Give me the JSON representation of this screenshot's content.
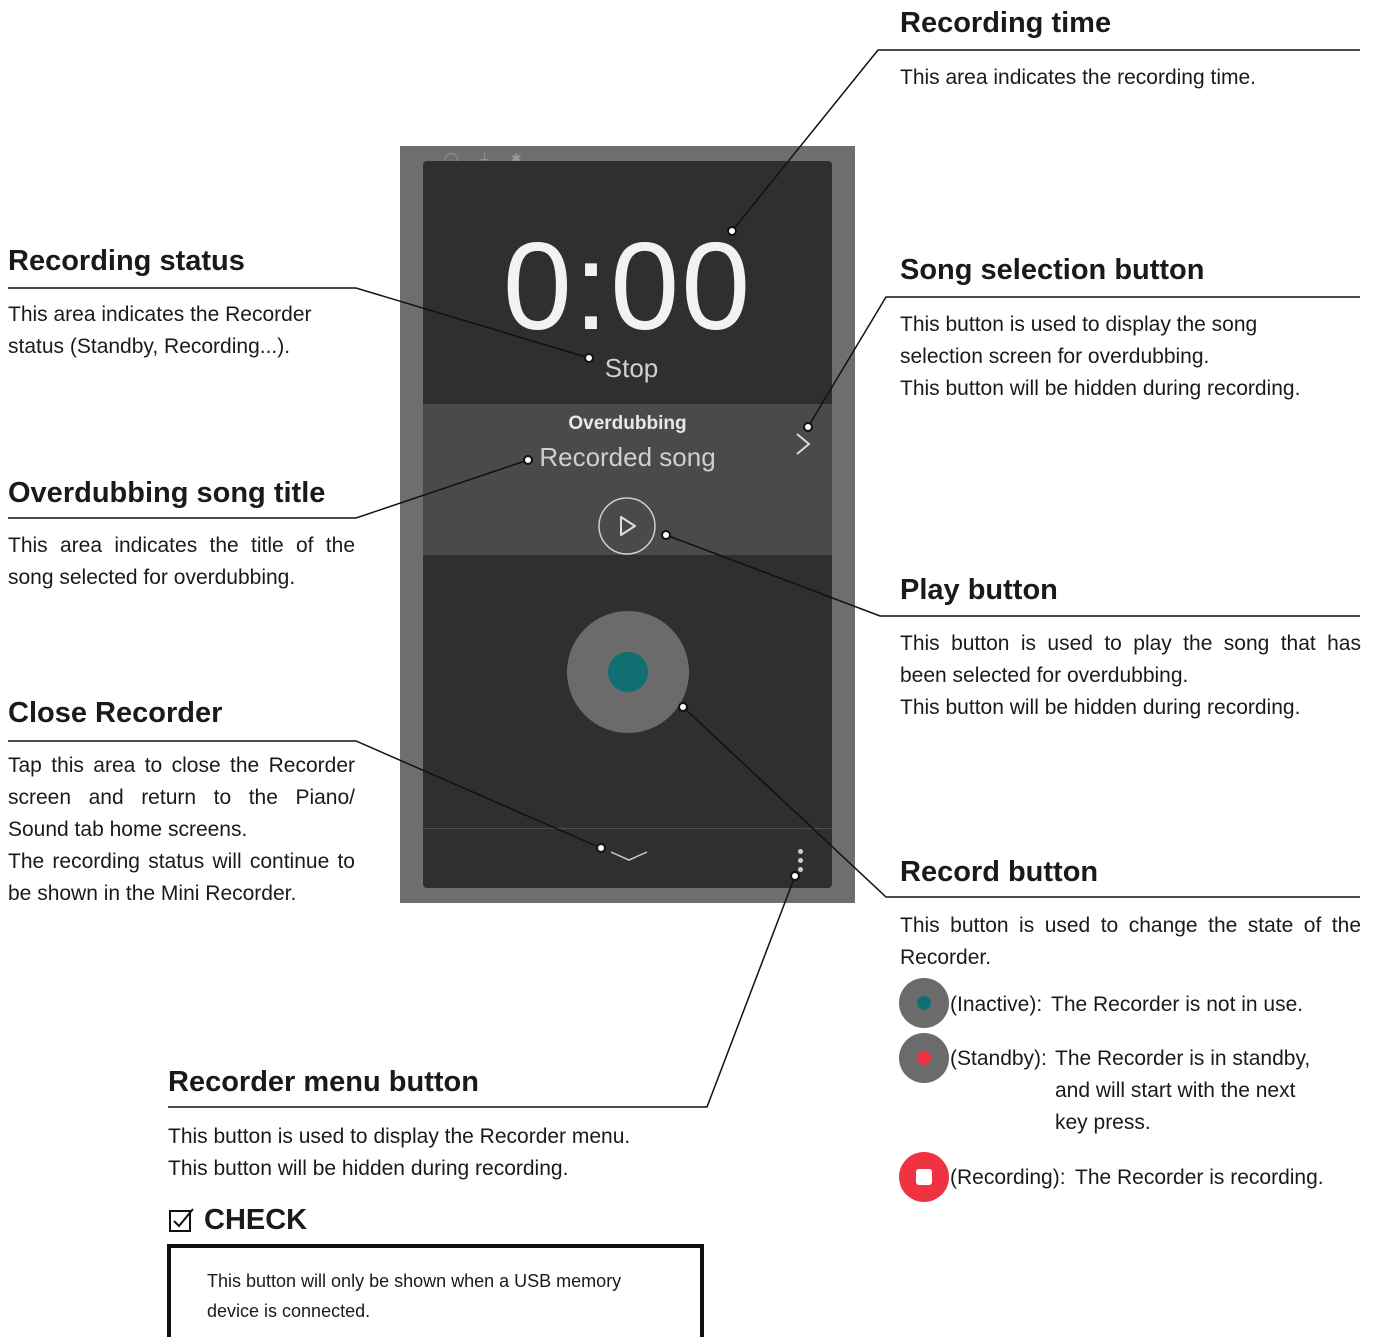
{
  "screen": {
    "status_icons": "◯ ⏚ ✱",
    "recording_time": "0:00",
    "recording_status": "Stop",
    "overdubbing_label": "Overdubbing",
    "overdubbing_song": "Recorded song",
    "colors": {
      "record_inactive": "#0f6f73",
      "record_button": "#6b6b6b",
      "recording_red": "#ef3340"
    }
  },
  "annotations": {
    "recording_time": {
      "title": "Recording time",
      "desc": "This area indicates the recording time."
    },
    "recording_status": {
      "title": "Recording status",
      "desc_1": "This area indicates the Recorder",
      "desc_2": "status (Standby, Recording...)."
    },
    "song_selection": {
      "title": "Song selection button",
      "desc_1": "This button is used to display the song",
      "desc_2": "selection screen for overdubbing.",
      "desc_3": "This button will be hidden during recording."
    },
    "overdubbing_title": {
      "title": "Overdubbing song title",
      "desc": "This area indicates the title of the song selected for overdubbing."
    },
    "play_button": {
      "title": "Play button",
      "desc_1": "This button is used to play the song that has been selected for overdubbing.",
      "desc_2": "This button will be hidden during recording."
    },
    "close_recorder": {
      "title": "Close Recorder",
      "desc_1": "Tap this area to close the Recorder screen and return to the Piano/ Sound tab home screens.",
      "desc_2": "The recording status will continue to be shown in the Mini Recorder."
    },
    "record_button": {
      "title": "Record button",
      "desc": "This button is used to change the state of the Recorder.",
      "states": [
        {
          "label": "(Inactive):",
          "text": "The Recorder is not in use."
        },
        {
          "label": "(Standby):",
          "text_1": "The Recorder is in standby,",
          "text_2": "and will start with the next",
          "text_3": "key press."
        },
        {
          "label": "(Recording):",
          "text": "The Recorder is recording."
        }
      ]
    },
    "recorder_menu": {
      "title": "Recorder menu button",
      "desc_1": "This button is used to display the Recorder menu.",
      "desc_2": "This button will be hidden during recording."
    }
  },
  "check": {
    "title": "CHECK",
    "text": "This button will only be shown when a USB memory device is connected."
  }
}
